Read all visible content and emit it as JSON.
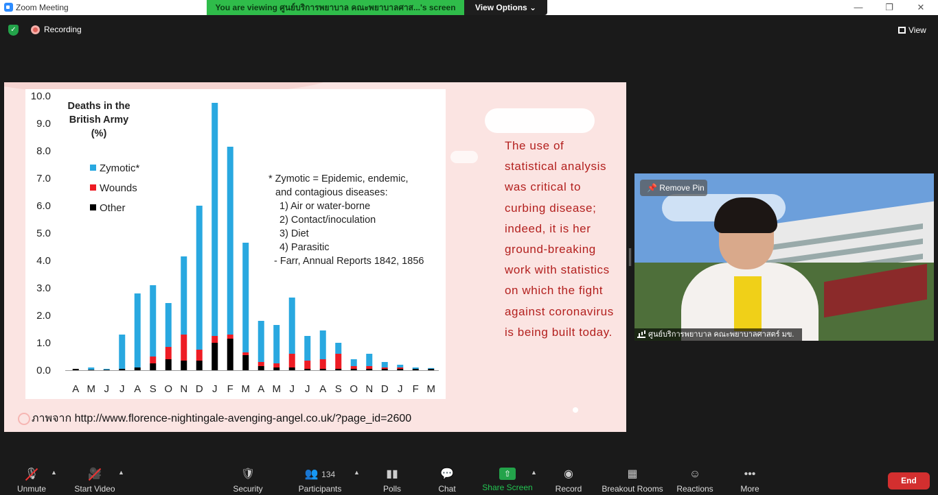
{
  "window": {
    "app_title": "Zoom Meeting",
    "banner_text": "You are viewing ศูนย์บริการพยาบาล คณะพยาบาลศาส...'s screen",
    "view_options": "View Options ⌄"
  },
  "meeting": {
    "recording_label": "Recording",
    "view_label": "View"
  },
  "slide": {
    "body_text": "The use of statistical analysis was critical to curbing disease; indeed, it is her ground-breaking work with statistics on which the fight against coronavirus is being built today.",
    "source_text": "ภาพจาก http://www.florence-nightingale-avenging-angel.co.uk/?page_id=2600"
  },
  "chart_data": {
    "type": "bar",
    "stacked": true,
    "title": [
      "Deaths in the",
      "British Army",
      "(%)"
    ],
    "categories": [
      "A",
      "M",
      "J",
      "J",
      "A",
      "S",
      "O",
      "N",
      "D",
      "J",
      "F",
      "M",
      "A",
      "M",
      "J",
      "J",
      "A",
      "S",
      "O",
      "N",
      "D",
      "J",
      "F",
      "M"
    ],
    "ylim": [
      0,
      10
    ],
    "yticks": [
      "0.0",
      "1.0",
      "2.0",
      "3.0",
      "4.0",
      "5.0",
      "6.0",
      "7.0",
      "8.0",
      "9.0",
      "10.0"
    ],
    "series": [
      {
        "name": "Other",
        "color": "#000000",
        "values": [
          0.05,
          0.02,
          0.02,
          0.05,
          0.1,
          0.25,
          0.4,
          0.35,
          0.35,
          1.0,
          1.15,
          0.55,
          0.15,
          0.1,
          0.1,
          0.05,
          0.05,
          0.05,
          0.05,
          0.05,
          0.05,
          0.05,
          0.05,
          0.05
        ]
      },
      {
        "name": "Wounds",
        "color": "#ed1c24",
        "values": [
          0.0,
          0.0,
          0.0,
          0.0,
          0.0,
          0.25,
          0.45,
          0.95,
          0.4,
          0.25,
          0.15,
          0.1,
          0.15,
          0.15,
          0.5,
          0.3,
          0.35,
          0.55,
          0.1,
          0.1,
          0.05,
          0.05,
          0.0,
          0.0
        ]
      },
      {
        "name": "Zymotic*",
        "color": "#29a8e0",
        "values": [
          0.0,
          0.08,
          0.03,
          1.25,
          2.7,
          2.6,
          1.6,
          2.85,
          5.25,
          8.5,
          6.85,
          4.0,
          1.5,
          1.4,
          2.05,
          0.9,
          1.05,
          0.4,
          0.25,
          0.45,
          0.2,
          0.1,
          0.05,
          0.03
        ]
      }
    ],
    "legend": [
      "Zymotic*",
      "Wounds",
      "Other"
    ],
    "annotation": [
      "* Zymotic = Epidemic, endemic,",
      "and contagious diseases:",
      "1) Air or water-borne",
      "2) Contact/inoculation",
      "3) Diet",
      "4) Parasitic",
      "- Farr, Annual Reports 1842, 1856"
    ]
  },
  "video": {
    "remove_pin": "Remove Pin",
    "participant_name": "ศูนย์บริการพยาบาล คณะพยาบาลศาสตร์ มข."
  },
  "toolbar": {
    "unmute": "Unmute",
    "start_video": "Start Video",
    "security": "Security",
    "participants": "Participants",
    "participants_count": "134",
    "polls": "Polls",
    "chat": "Chat",
    "share_screen": "Share Screen",
    "record": "Record",
    "breakout_rooms": "Breakout Rooms",
    "reactions": "Reactions",
    "more": "More",
    "end": "End"
  }
}
